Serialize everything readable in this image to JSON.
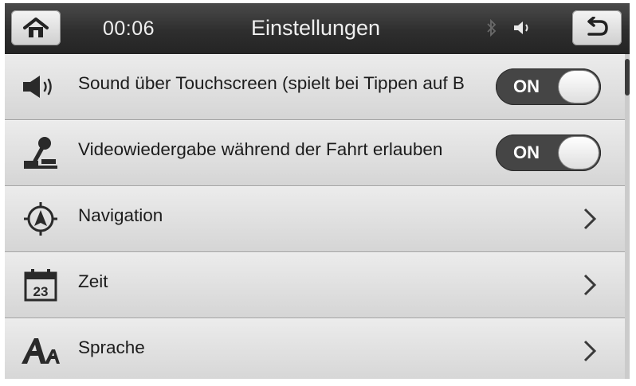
{
  "header": {
    "clock": "00:06",
    "title": "Einstellungen",
    "home_icon": "home-icon",
    "back_icon": "back-icon",
    "status_icons": [
      "bluetooth-icon",
      "speaker-icon"
    ]
  },
  "settings": [
    {
      "label": "Sound über Touchscreen (spielt bei Tippen auf B",
      "icon": "speaker-icon",
      "control": "toggle",
      "value": "ON"
    },
    {
      "label": "Videowiedergabe während der Fahrt erlauben",
      "icon": "joystick-icon",
      "control": "toggle",
      "value": "ON"
    },
    {
      "label": "Navigation",
      "icon": "compass-icon",
      "control": "chevron"
    },
    {
      "label": "Zeit",
      "icon": "calendar-icon",
      "control": "chevron",
      "icon_text": "23"
    },
    {
      "label": "Sprache",
      "icon": "language-icon",
      "control": "chevron"
    }
  ],
  "scroll": {
    "position": 0
  }
}
